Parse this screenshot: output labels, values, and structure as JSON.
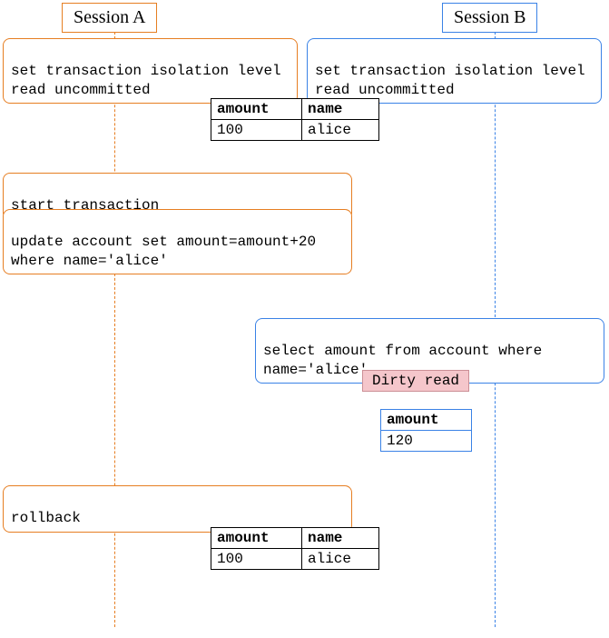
{
  "sessionA": {
    "title": "Session A"
  },
  "sessionB": {
    "title": "Session B"
  },
  "stmt": {
    "a_iso": "set transaction isolation level read uncommitted",
    "b_iso": "set transaction isolation level read uncommitted",
    "a_start": "start transaction",
    "a_update": "update account set amount=amount+20 where name='alice'",
    "b_select": "select amount from account where name='alice'",
    "a_rollback": "rollback"
  },
  "label": {
    "dirty": "Dirty read"
  },
  "table1": {
    "h1": "amount",
    "h2": "name",
    "v1": "100",
    "v2": "alice"
  },
  "table2": {
    "h1": "amount",
    "v1": "120"
  },
  "table3": {
    "h1": "amount",
    "h2": "name",
    "v1": "100",
    "v2": "alice"
  }
}
